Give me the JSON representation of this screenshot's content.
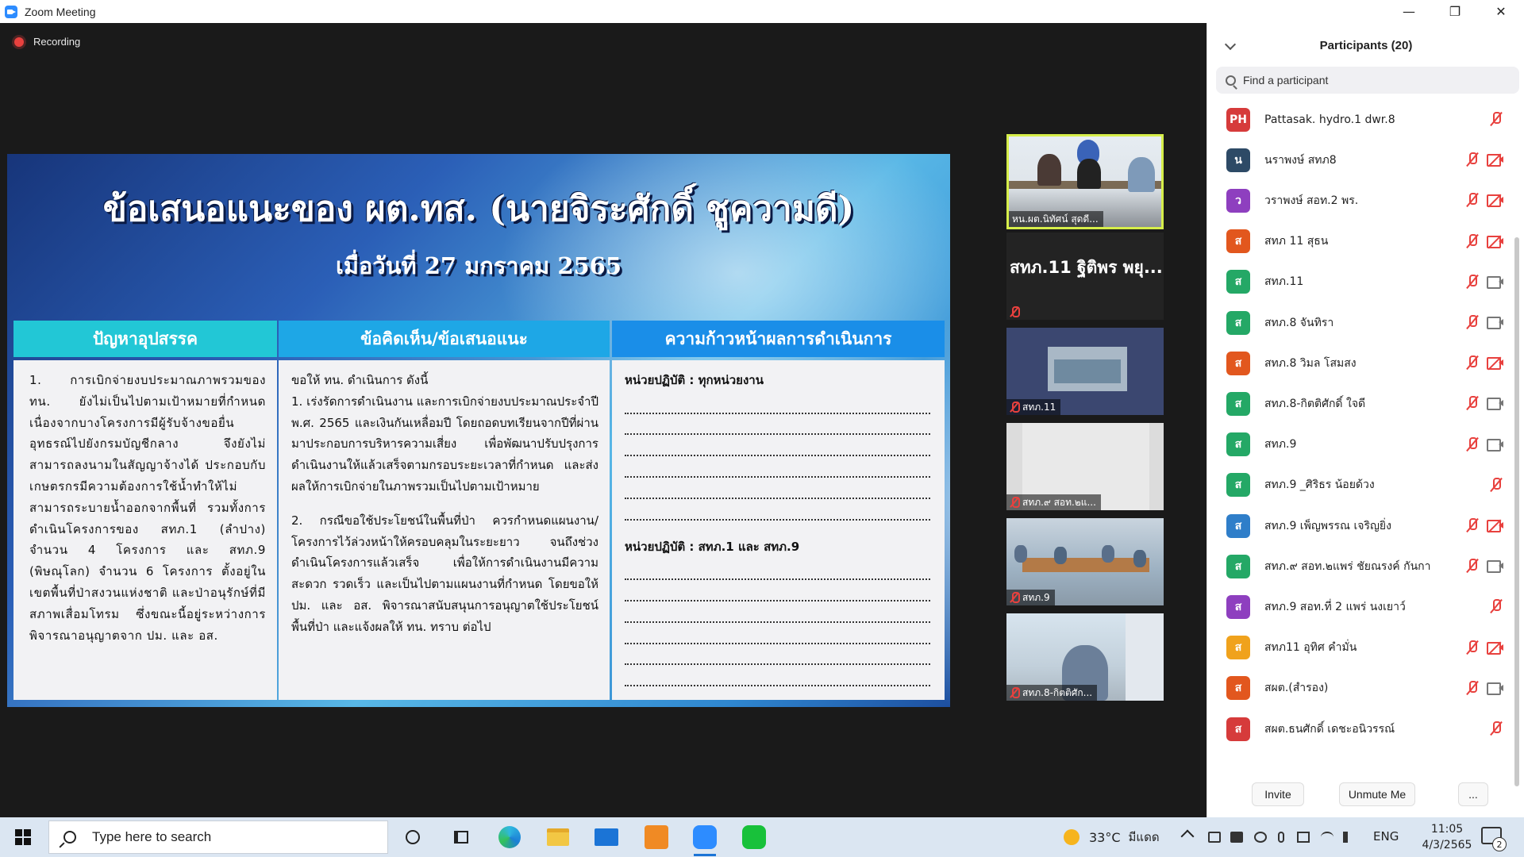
{
  "window": {
    "title": "Zoom Meeting",
    "minimize": "—",
    "maximize": "❐",
    "close": "✕"
  },
  "recording": {
    "label": "Recording"
  },
  "slide": {
    "title": "ข้อเสนอแนะของ ผต.ทส. (นายจิระศักดิ์  ชูความดี)",
    "subtitle": "เมื่อวันที่  27  มกราคม  2565",
    "columns": [
      {
        "header": "ปัญหาอุปสรรค"
      },
      {
        "header": "ข้อคิดเห็น/ข้อเสนอแนะ"
      },
      {
        "header": "ความก้าวหน้าผลการดำเนินการ"
      }
    ],
    "col1_text": "1. การเบิกจ่ายงบประมาณภาพรวมของ ทน. ยังไม่เป็นไปตามเป้าหมายที่กำหนด เนื่องจากบางโครงการมีผู้รับจ้างขอยื่นอุทธรณ์ไปยังกรมบัญชีกลาง จึงยังไม่สามารถลงนามในสัญญาจ้างได้ ประกอบกับเกษตรกรมีความต้องการใช้น้ำทำให้ไม่สามารถระบายน้ำออกจากพื้นที่ รวมทั้งการดำเนินโครงการของ สทภ.1 (ลำปาง) จำนวน 4 โครงการ และ สทภ.9 (พิษณุโลก) จำนวน 6 โครงการ ตั้งอยู่ในเขตพื้นที่ป่าสงวนแห่งชาติ และป่าอนุรักษ์ที่มีสภาพเสื่อมโทรม ซึ่งขณะนี้อยู่ระหว่างการพิจารณาอนุญาตจาก ปม. และ อส.",
    "col2_intro": "ขอให้ ทน. ดำเนินการ ดังนี้",
    "col2_p1": "1. เร่งรัดการดำเนินงาน และการเบิกจ่ายงบประมาณประจำปี พ.ศ. 2565 และเงินกันเหลื่อมปี โดยถอดบทเรียนจากปีที่ผ่านมาประกอบการบริหารความเสี่ยง เพื่อพัฒนาปรับปรุงการดำเนินงานให้แล้วเสร็จตามกรอบระยะเวลาที่กำหนด และส่งผลให้การเบิกจ่ายในภาพรวมเป็นไปตามเป้าหมาย",
    "col2_p2": "2. กรณีขอใช้ประโยชน์ในพื้นที่ป่า ควรกำหนดแผนงาน/โครงการไว้ล่วงหน้าให้ครอบคลุมในระยะยาว จนถึงช่วงดำเนินโครงการแล้วเสร็จ เพื่อให้การดำเนินงานมีความสะดวก รวดเร็ว และเป็นไปตามแผนงานที่กำหนด โดยขอให้ ปม. และ อส. พิจารณาสนับสนุนการอนุญาตใช้ประโยชน์พื้นที่ป่า และแจ้งผลให้ ทน. ทราบ ต่อไป",
    "col3_unit1": "หน่วยปฏิบัติ : ทุกหน่วยงาน",
    "col3_unit2": "หน่วยปฏิบัติ : สทภ.1 และ สทภ.9"
  },
  "videos": [
    {
      "label": "หน.ผต.นิทัศน์ สุดดี..."
    },
    {
      "label": "สทภ.11 ฐิติพร พยุ..."
    },
    {
      "label": "สทภ.11"
    },
    {
      "label": "สทภ.๙ สอท.๒แ..."
    },
    {
      "label": "สทภ.9"
    },
    {
      "label": "สทภ.8-กิตติศัก..."
    }
  ],
  "participants": {
    "title": "Participants (20)",
    "search_placeholder": "Find a participant",
    "items": [
      {
        "initials": "PH",
        "name": "Pattasak. hydro.1 dwr.8",
        "color": "#d63b3b",
        "icons": "mic"
      },
      {
        "initials": "น",
        "name": "นราพงษ์ สทภ8",
        "color": "#2d4a66",
        "icons": "mic-cam-off"
      },
      {
        "initials": "ว",
        "name": "วราพงษ์ สอท.2 พร.",
        "color": "#8e3fbf",
        "icons": "mic-cam-off"
      },
      {
        "initials": "ส",
        "name": "สทภ 11 สุธน",
        "color": "#e2571e",
        "icons": "mic-cam-off"
      },
      {
        "initials": "ส",
        "name": "สทภ.11",
        "color": "#24a866",
        "icons": "mic-cam"
      },
      {
        "initials": "ส",
        "name": "สทภ.8 จันทิรา",
        "color": "#24a866",
        "icons": "mic-cam"
      },
      {
        "initials": "ส",
        "name": "สทภ.8 วิมล โสมสง",
        "color": "#e2571e",
        "icons": "mic-cam-off"
      },
      {
        "initials": "ส",
        "name": "สทภ.8-กิตติศักดิ์ ใจดี",
        "color": "#24a866",
        "icons": "mic-cam"
      },
      {
        "initials": "ส",
        "name": "สทภ.9",
        "color": "#24a866",
        "icons": "mic-cam"
      },
      {
        "initials": "ส",
        "name": "สทภ.9 _ศิริธร น้อยด้วง",
        "color": "#24a866",
        "icons": "mic"
      },
      {
        "initials": "ส",
        "name": "สทภ.9 เพ็ญพรรณ เจริญยิ่ง",
        "color": "#2f7ec9",
        "icons": "mic-cam-off"
      },
      {
        "initials": "ส",
        "name": "สทภ.๙ สอท.๒แพร่ ชัยณรงค์ กันกา",
        "color": "#24a866",
        "icons": "mic-cam"
      },
      {
        "initials": "ส",
        "name": "สทภ.9 สอท.ที่ 2 แพร่ นงเยาว์",
        "color": "#8e3fbf",
        "icons": "mic"
      },
      {
        "initials": "ส",
        "name": "สทภ11 อุทิศ คำมั่น",
        "color": "#f0a21c",
        "icons": "mic-cam-off"
      },
      {
        "initials": "ส",
        "name": "สผต.(สำรอง)",
        "color": "#e2571e",
        "icons": "mic-cam"
      },
      {
        "initials": "ส",
        "name": "สผต.ธนศักดิ์ เดชะอนิวรรณ์",
        "color": "#d63b3b",
        "icons": "mic"
      }
    ],
    "footer": {
      "invite": "Invite",
      "unmute": "Unmute Me",
      "more": "..."
    }
  },
  "taskbar": {
    "search_placeholder": "Type here to search",
    "temperature": "33°C",
    "condition": "มีแดด",
    "language": "ENG",
    "time": "11:05",
    "date": "4/3/2565",
    "notifications": "2"
  }
}
